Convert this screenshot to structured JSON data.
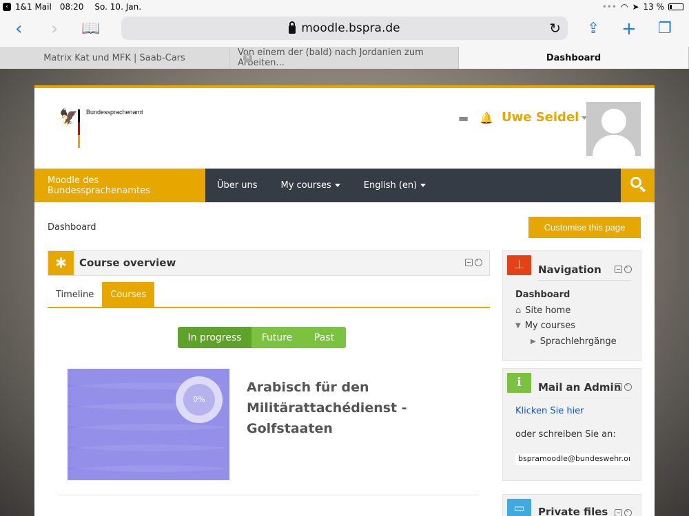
{
  "statusbar": {
    "back_app": "1&1 Mail",
    "time": "08:20",
    "date": "So. 10. Jan.",
    "battery": "13 %"
  },
  "browser": {
    "url": "moodle.bspra.de",
    "tabs": [
      {
        "label": "Matrix Kat und MFK | Saab-Cars"
      },
      {
        "label": "Von einem der (bald) nach Jordanien zum Arbeiten..."
      },
      {
        "label": "Dashboard"
      }
    ]
  },
  "site": {
    "logo_text": "Bundessprachenamt",
    "user_name": "Uwe Seidel",
    "nav": {
      "brand": "Moodle des Bundessprachenamtes",
      "items": [
        "Über uns",
        "My courses",
        "English (en)"
      ]
    },
    "breadcrumb": "Dashboard",
    "customise_label": "Customise this page"
  },
  "course_overview": {
    "title": "Course overview",
    "tabs": [
      "Timeline",
      "Courses"
    ],
    "filters": [
      "In progress",
      "Future",
      "Past"
    ],
    "course": {
      "title": "Arabisch für den Militärattachédienst - Golfstaaten",
      "progress_label": "0%",
      "progress": 0
    }
  },
  "navigation_block": {
    "title": "Navigation",
    "items": [
      "Dashboard",
      "Site home",
      "My courses",
      "Sprachlehrgänge"
    ]
  },
  "mail_block": {
    "title": "Mail an Admin",
    "link": "Klicken Sie hier",
    "text": "oder schreiben Sie an:",
    "email": "bspramoodle@bundeswehr.org"
  },
  "files_block": {
    "title": "Private files"
  },
  "colors": {
    "accent": "#e6a700",
    "navbar": "#353c46",
    "green_active": "#5ea22a",
    "green": "#7cc241",
    "navigation_icon": "#e34116",
    "mail_icon": "#7cc241",
    "files_icon": "#3fa9e0"
  }
}
